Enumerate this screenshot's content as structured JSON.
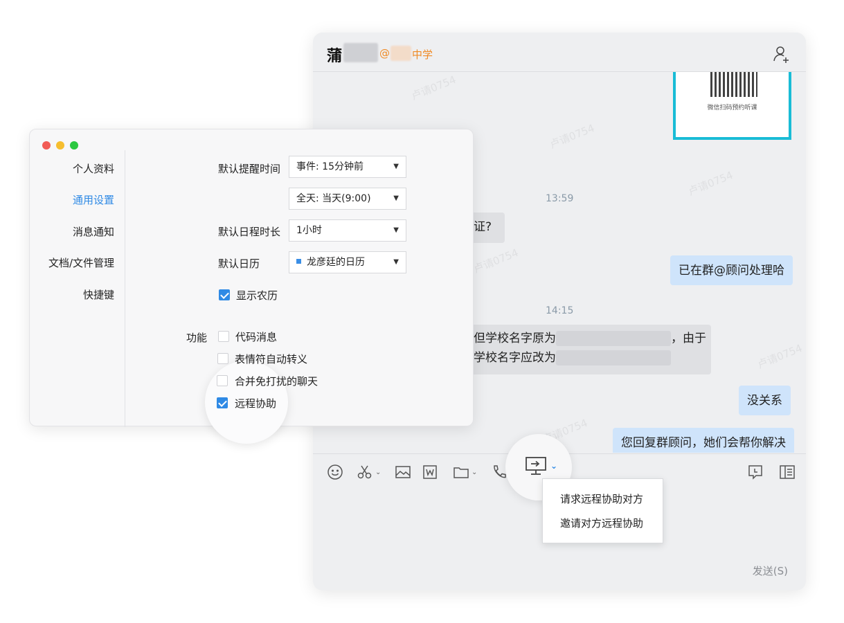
{
  "chat": {
    "name_initial": "蒲",
    "org_at": "@",
    "org_suffix": "中学",
    "qr_caption": "微信扫码预约听课",
    "watermark": "卢请0754",
    "time_1": "13:59",
    "msg_in_1": "证?",
    "msg_out_1": "已在群@顾问处理哈",
    "time_2": "14:15",
    "msg_in_2_line1_prefix": "但学校名字原为",
    "msg_in_2_line1_suffix": "，由于",
    "msg_in_2_line2_prefix": "学校名字应改为",
    "msg_out_2": "没关系",
    "msg_out_3": "您回复群顾问，她们会帮你解决",
    "send_label": "发送(S)",
    "remote_menu": {
      "items": [
        "请求远程协助对方",
        "邀请对方远程协助"
      ]
    }
  },
  "settings": {
    "sidebar": {
      "items": [
        "个人资料",
        "通用设置",
        "消息通知",
        "文档/文件管理",
        "快捷键"
      ],
      "active": "通用设置"
    },
    "reminder_label": "默认提醒时间",
    "reminder_event": "事件: 15分钟前",
    "reminder_allday": "全天: 当天(9:00)",
    "duration_label": "默认日程时长",
    "duration_value": "1小时",
    "calendar_label": "默认日历",
    "calendar_value": "龙彦廷的日历",
    "lunar_label": "显示农历",
    "lunar_checked": true,
    "function_label": "功能",
    "functions": [
      {
        "label": "代码消息",
        "checked": false
      },
      {
        "label": "表情符自动转义",
        "checked": false
      },
      {
        "label": "合并免打扰的聊天",
        "checked": false
      },
      {
        "label": "远程协助",
        "checked": true
      }
    ]
  },
  "colors": {
    "accent": "#2f8ae5",
    "org": "#f08a24",
    "traffic_red": "#f15b55",
    "traffic_yellow": "#f6be2f",
    "traffic_green": "#2bc840"
  }
}
